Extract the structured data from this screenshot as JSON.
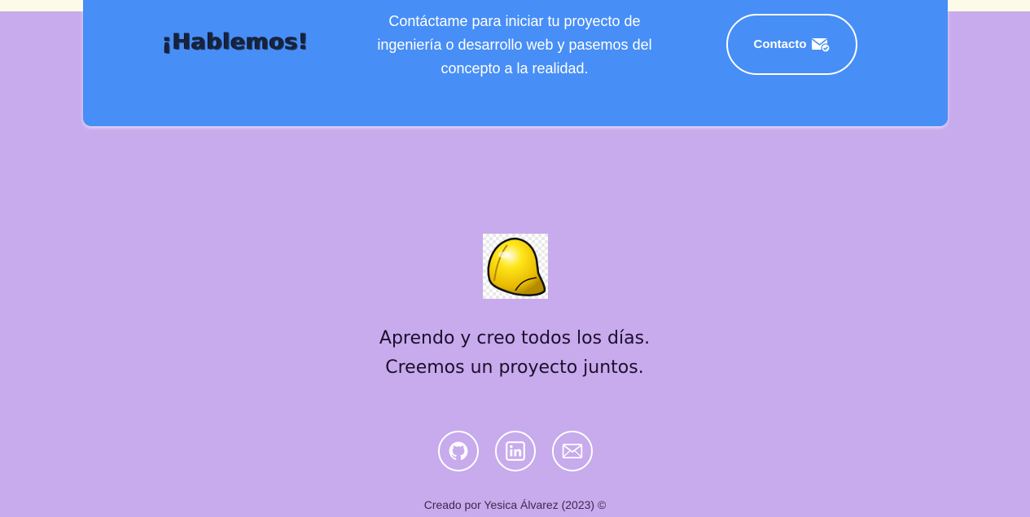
{
  "cta": {
    "title": "¡Hablemos!",
    "text": "Contáctame para iniciar tu proyecto de ingeniería o desarrollo web y pasemos del concepto a la realidad.",
    "button_label": "Contacto",
    "button_icon": "mail-check-icon"
  },
  "hero": {
    "image_icon": "hard-hat-icon",
    "line1": "Aprendo y creo todos los días.",
    "line2": "Creemos un proyecto juntos."
  },
  "social": [
    {
      "icon": "github-icon"
    },
    {
      "icon": "linkedin-icon"
    },
    {
      "icon": "email-icon"
    }
  ],
  "footer": {
    "credit": "Creado por Yesica Álvarez (2023) ©"
  },
  "colors": {
    "background": "#c7abed",
    "card": "#478ef7",
    "top_strip": "#fdfbe8",
    "helmet": "#ffd200"
  }
}
